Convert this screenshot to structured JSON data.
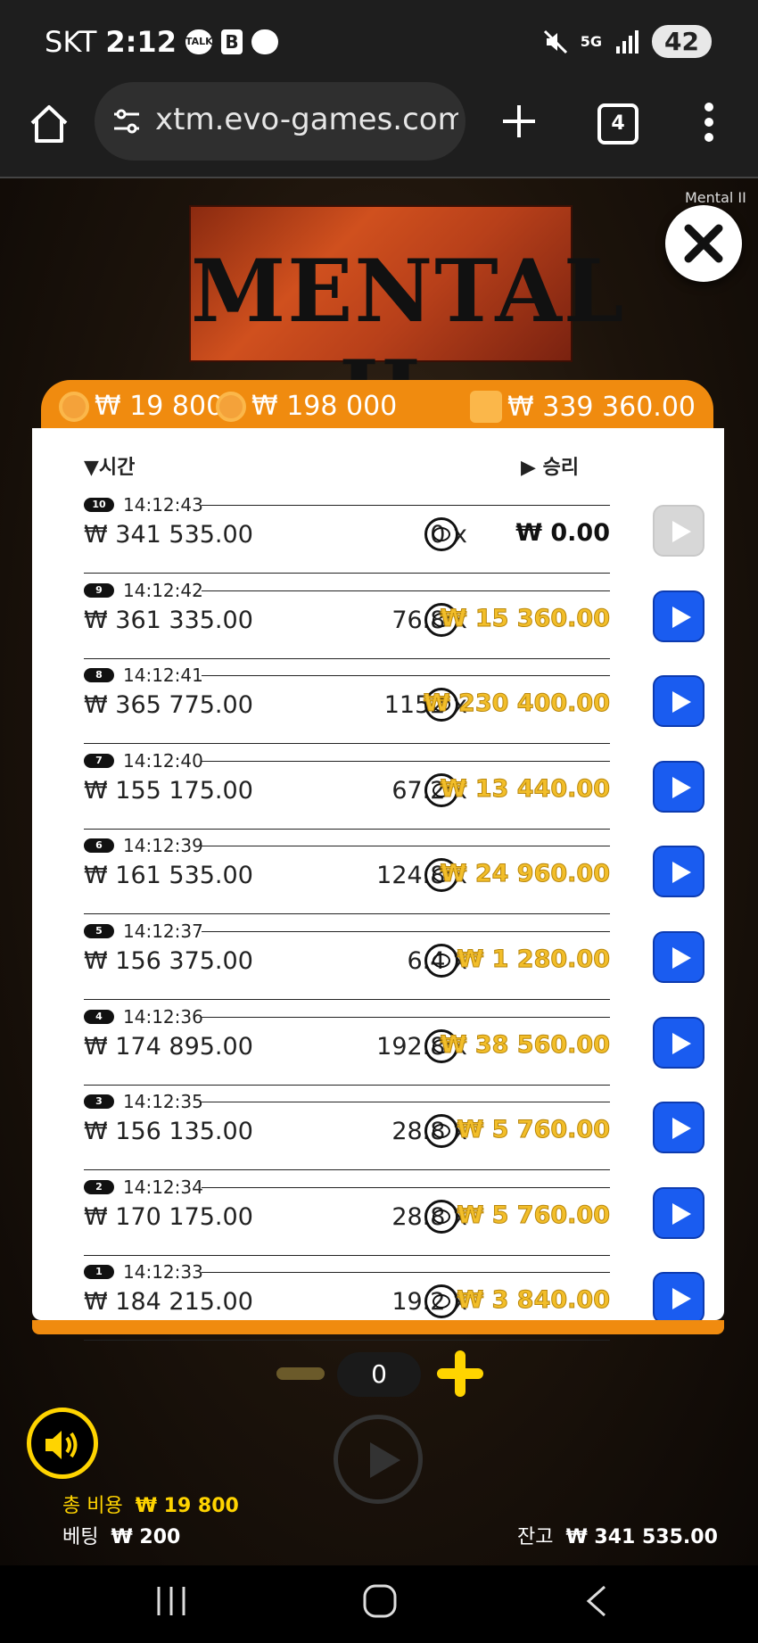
{
  "status_bar": {
    "carrier": "SKT",
    "time": "2:12",
    "talk_icon_label": "TALK",
    "b_icon_label": "B",
    "network": "5G",
    "battery": "42"
  },
  "browser": {
    "url": "xtm.evo-games.com",
    "tab_count": "4"
  },
  "game": {
    "title_overlay": "Mental II",
    "logo_text": "MENTAL II",
    "header": {
      "coin_small": "₩ 19 800",
      "coin_big": "₩ 198 000",
      "balance": "₩ 339 360.00"
    },
    "columns": {
      "time": "시간",
      "win": "승리"
    },
    "rows": [
      {
        "num": "10",
        "time": "14:12:43",
        "balance": "₩ 341 535.00",
        "mult": "0 x",
        "win": "₩ 0.00",
        "zero": true
      },
      {
        "num": "9",
        "time": "14:12:42",
        "balance": "₩ 361 335.00",
        "mult": "76.8 x",
        "win": "₩ 15 360.00",
        "zero": false
      },
      {
        "num": "8",
        "time": "14:12:41",
        "balance": "₩ 365 775.00",
        "mult": "1152 x",
        "win": "₩ 230 400.00",
        "zero": false
      },
      {
        "num": "7",
        "time": "14:12:40",
        "balance": "₩ 155 175.00",
        "mult": "67.2 x",
        "win": "₩ 13 440.00",
        "zero": false
      },
      {
        "num": "6",
        "time": "14:12:39",
        "balance": "₩ 161 535.00",
        "mult": "124.8 x",
        "win": "₩ 24 960.00",
        "zero": false
      },
      {
        "num": "5",
        "time": "14:12:37",
        "balance": "₩ 156 375.00",
        "mult": "6.4 x",
        "win": "₩ 1 280.00",
        "zero": false
      },
      {
        "num": "4",
        "time": "14:12:36",
        "balance": "₩ 174 895.00",
        "mult": "192.8 x",
        "win": "₩ 38 560.00",
        "zero": false
      },
      {
        "num": "3",
        "time": "14:12:35",
        "balance": "₩ 156 135.00",
        "mult": "28.8 x",
        "win": "₩ 5 760.00",
        "zero": false
      },
      {
        "num": "2",
        "time": "14:12:34",
        "balance": "₩ 170 175.00",
        "mult": "28.8 x",
        "win": "₩ 5 760.00",
        "zero": false
      },
      {
        "num": "1",
        "time": "14:12:33",
        "balance": "₩ 184 215.00",
        "mult": "19.2 x",
        "win": "₩ 3 840.00",
        "zero": false
      }
    ],
    "bet_value": "0",
    "total_cost_label": "총 비용",
    "total_cost": "₩ 19 800",
    "bet_label": "베팅",
    "bet": "₩ 200",
    "balance_label": "잔고",
    "balance": "₩ 341 535.00"
  },
  "colors": {
    "accent": "#f08b0f",
    "play": "#1a5cf0",
    "win": "#f2be2a",
    "sound": "#ffd400"
  }
}
